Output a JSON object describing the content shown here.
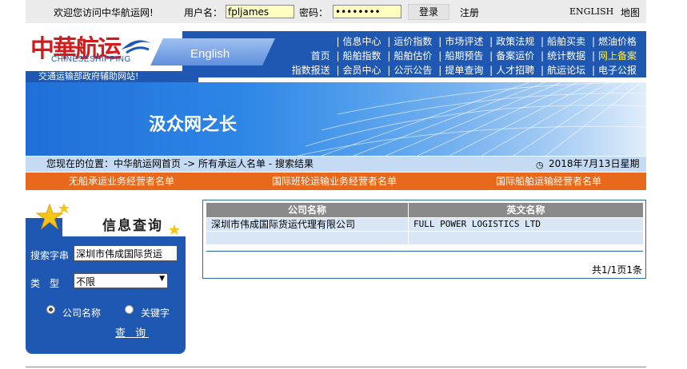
{
  "topbar": {
    "welcome": "欢迎您访问中华航运网!",
    "username_label": "用户名：",
    "username_value": "fpljames",
    "password_label": "密码：",
    "password_value": "••••••••",
    "login_label": "登录",
    "register_label": "注册",
    "english_label": "ENGLISH",
    "sitemap_label": "地图"
  },
  "header": {
    "logo_cn": "中華航运",
    "logo_en": "CHINESESHIPPING",
    "english_tab": "English",
    "slogan": "交通运输部政府辅助网站!",
    "nav_rows": [
      [
        "信息中心",
        "运价指数",
        "市场评述",
        "政策法规",
        "船舶买卖",
        "燃油价格"
      ],
      [
        "首页",
        "船舶指数",
        "船舶估价",
        "船期预告",
        "备案运价",
        "统计数据",
        "网上备案"
      ],
      [
        "指数报送",
        "会员中心",
        "公示公告",
        "提单查询",
        "人才招聘",
        "航运论坛",
        "电子公报"
      ]
    ]
  },
  "banner": {
    "title": "汲众网之长"
  },
  "breadcrumb": {
    "text": "您现在的位置：中华航运网首页 -> 所有承运人名单 - 搜索结果",
    "date": "2018年7月13日星期五"
  },
  "orange_bar": {
    "items": [
      "无船承运业务经营者名单",
      "国际班轮运输业务经营者名单",
      "国际船舶运输经营者名单"
    ]
  },
  "query": {
    "title": "信息查询",
    "keyword_label": "搜索字串",
    "keyword_value": "深圳市伟成国际货运",
    "type_label": "类　型",
    "type_value": "不限",
    "radio_company": "公司名称",
    "radio_keyword": "关键字",
    "submit_label": "查 询"
  },
  "results": {
    "headers": [
      "公司名称",
      "英文名称"
    ],
    "rows": [
      [
        "深圳市伟成国际货运代理有限公司",
        "FULL POWER LOGISTICS LTD"
      ]
    ],
    "pager": "共1/1页1条"
  },
  "colors": {
    "nav_blue": "#1f58b2",
    "orange": "#e8681c",
    "highlight": "#ffee44"
  }
}
